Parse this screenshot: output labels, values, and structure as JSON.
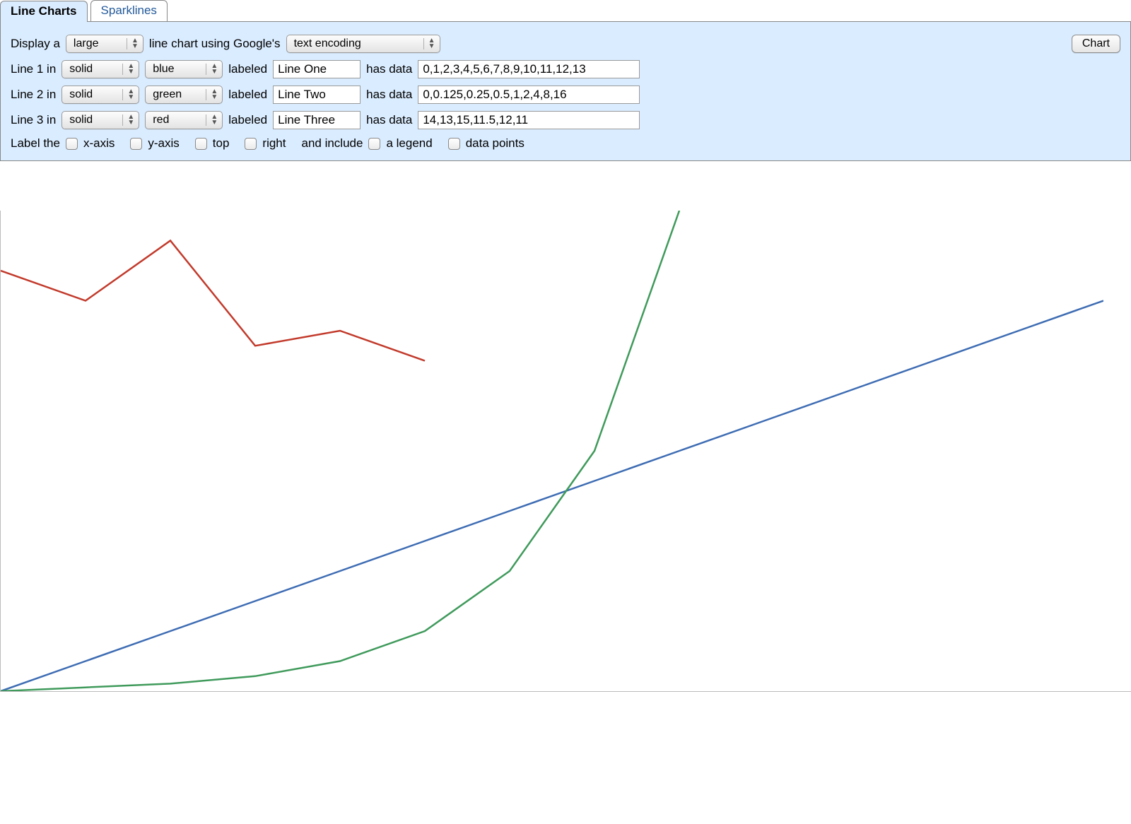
{
  "tabs": [
    {
      "label": "Line Charts",
      "active": true
    },
    {
      "label": "Sparklines",
      "active": false
    }
  ],
  "topRow": {
    "prefix": "Display a",
    "sizeSelect": "large",
    "mid": "line chart using Google's",
    "encodingSelect": "text encoding",
    "chartButton": "Chart"
  },
  "lines": [
    {
      "prefix": "Line 1 in",
      "style": "solid",
      "color": "blue",
      "labeledWord": "labeled",
      "label": "Line One",
      "hasData": "has data",
      "data": "0,1,2,3,4,5,6,7,8,9,10,11,12,13"
    },
    {
      "prefix": "Line 2 in",
      "style": "solid",
      "color": "green",
      "labeledWord": "labeled",
      "label": "Line Two",
      "hasData": "has data",
      "data": "0,0.125,0.25,0.5,1,2,4,8,16"
    },
    {
      "prefix": "Line 3 in",
      "style": "solid",
      "color": "red",
      "labeledWord": "labeled",
      "label": "Line Three",
      "hasData": "has data",
      "data": "14,13,15,11.5,12,11"
    }
  ],
  "axisRow": {
    "prefix": "Label the",
    "xaxis": "x-axis",
    "yaxis": "y-axis",
    "top": "top",
    "right": "right",
    "andInclude": "and include",
    "legend": "a legend",
    "dataPoints": "data points"
  },
  "chart_data": {
    "type": "line",
    "title": "",
    "xlabel": "",
    "ylabel": "",
    "ylim": [
      0,
      16
    ],
    "series": [
      {
        "name": "Line One",
        "color": "#3d6cb3",
        "values": [
          0,
          1,
          2,
          3,
          4,
          5,
          6,
          7,
          8,
          9,
          10,
          11,
          12,
          13
        ]
      },
      {
        "name": "Line Two",
        "color": "#3f9a5b",
        "values": [
          0,
          0.125,
          0.25,
          0.5,
          1,
          2,
          4,
          8,
          16
        ]
      },
      {
        "name": "Line Three",
        "color": "#c23a2b",
        "values": [
          14,
          13,
          15,
          11.5,
          12,
          11
        ]
      }
    ],
    "grid": false,
    "legend": false
  }
}
